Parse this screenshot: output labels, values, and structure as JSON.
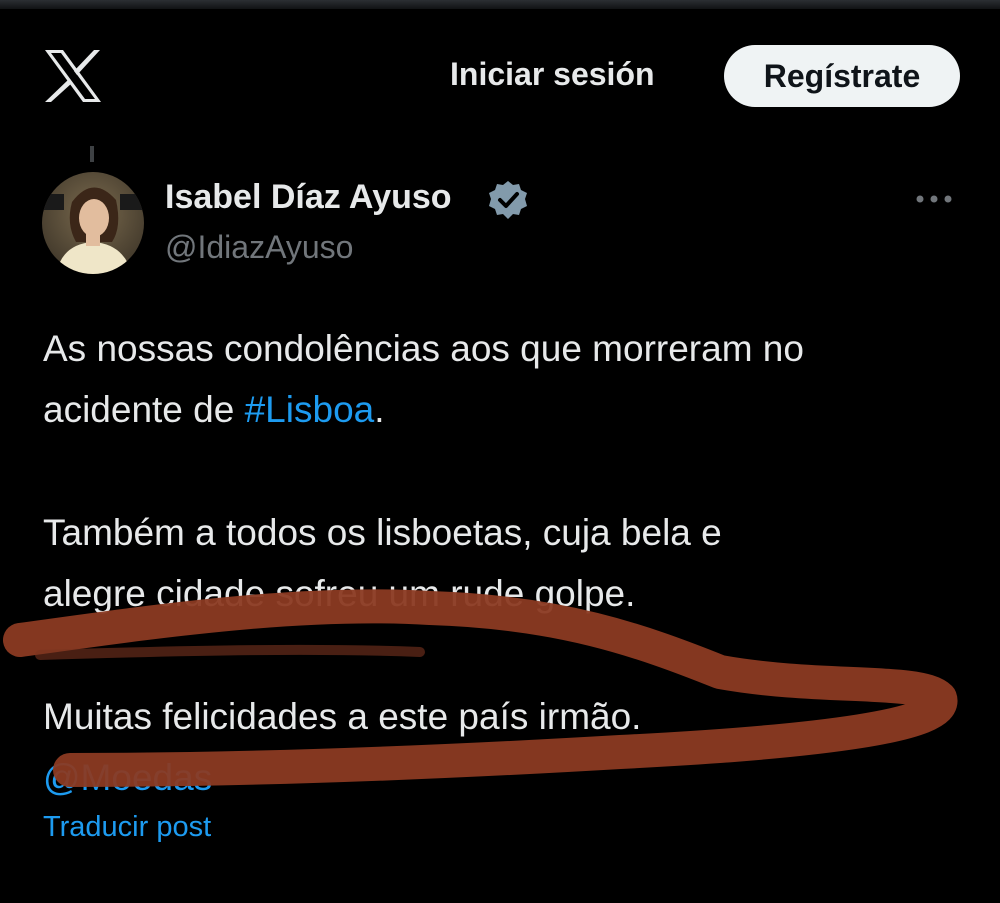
{
  "header": {
    "logo_icon": "x-logo-icon",
    "login_label": "Iniciar sesión",
    "signup_label": "Regístrate"
  },
  "tweet": {
    "display_name": "Isabel Díaz Ayuso",
    "handle": "@IdiazAyuso",
    "verified_icon": "verified-badge-icon",
    "more_icon": "more-options-icon",
    "line1": "As nossas condolências aos que morreram no",
    "line2_prefix": "acidente de ",
    "hashtag": "#Lisboa",
    "line2_suffix": ".",
    "line3": "Também a todos os lisboetas, cuja bela e",
    "line4": "alegre cidade sofreu um rude golpe.",
    "line5": "Muitas felicidades a este país irmão.",
    "mention": "@Moedas",
    "translate_label": "Traducir post"
  },
  "colors": {
    "background": "#000000",
    "text": "#e7e9ea",
    "secondary_text": "#71767b",
    "link": "#1d9bf0",
    "annotation_stroke": "#8b3a22"
  }
}
